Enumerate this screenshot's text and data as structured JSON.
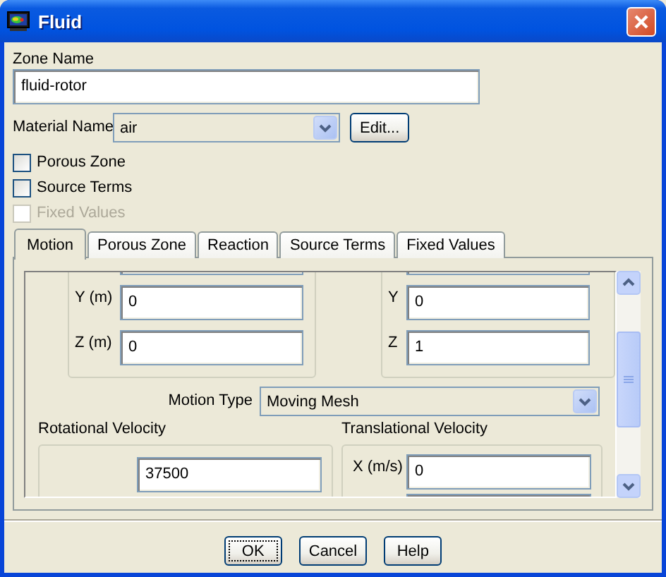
{
  "window": {
    "title": "Fluid"
  },
  "zone_name": {
    "label": "Zone Name",
    "value": "fluid-rotor"
  },
  "material": {
    "label": "Material Name",
    "value": "air",
    "button": "Edit..."
  },
  "checkboxes": [
    {
      "label": "Porous Zone",
      "checked": false,
      "disabled": false
    },
    {
      "label": "Source Terms",
      "checked": false,
      "disabled": false
    },
    {
      "label": "Fixed Values",
      "checked": false,
      "disabled": true
    }
  ],
  "tabs": [
    {
      "label": "Motion",
      "selected": true
    },
    {
      "label": "Porous Zone",
      "selected": false
    },
    {
      "label": "Reaction",
      "selected": false
    },
    {
      "label": "Source Terms",
      "selected": false
    },
    {
      "label": "Fixed Values",
      "selected": false
    }
  ],
  "motion": {
    "left_group": {
      "rows": [
        {
          "label": "Y (m)",
          "value": "0"
        },
        {
          "label": "Z (m)",
          "value": "0"
        }
      ]
    },
    "right_group": {
      "rows": [
        {
          "label": "Y",
          "value": "0"
        },
        {
          "label": "Z",
          "value": "1"
        }
      ]
    },
    "motion_type": {
      "label": "Motion Type",
      "value": "Moving Mesh"
    },
    "rotational_velocity": {
      "title": "Rotational Velocity",
      "value": "37500"
    },
    "translational_velocity": {
      "title": "Translational Velocity",
      "rows": [
        {
          "label": "X (m/s)",
          "value": "0"
        }
      ]
    }
  },
  "buttons": [
    {
      "label": "OK",
      "focused": true
    },
    {
      "label": "Cancel",
      "focused": false
    },
    {
      "label": "Help",
      "focused": false
    }
  ]
}
